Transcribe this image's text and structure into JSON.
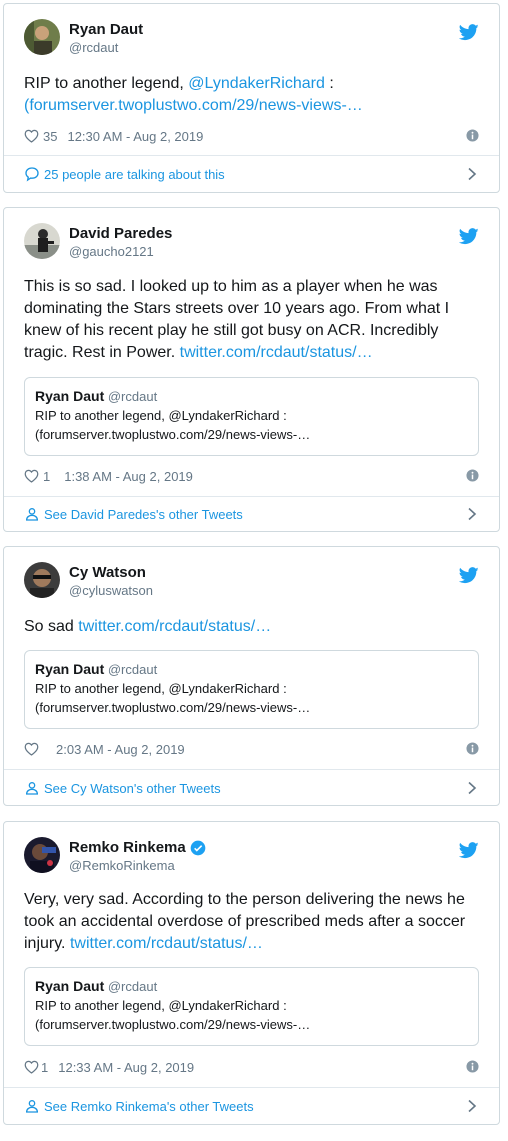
{
  "tweets": [
    {
      "name": "Ryan Daut",
      "handle": "@rcdaut",
      "text_before": "RIP to another legend, ",
      "mention": "@LyndakerRichard",
      "text_middle": " :",
      "link": "(forumserver.twoplustwo.com/29/news-views-…",
      "likes": "35",
      "time": "12:30 AM - Aug 2, 2019",
      "footer": "25 people are talking about this"
    },
    {
      "name": "David Paredes",
      "handle": "@gaucho2121",
      "text": "This is so sad. I looked up to him as a player when he was dominating the Stars streets over 10 years ago. From what I knew of his recent play he still got busy on ACR. Incredibly tragic. Rest in Power. ",
      "link": "twitter.com/rcdaut/status/…",
      "likes": "1",
      "time": "1:38 AM - Aug 2, 2019",
      "footer": "See David Paredes's other Tweets"
    },
    {
      "name": "Cy Watson",
      "handle": "@cyluswatson",
      "text": "So sad ",
      "link": "twitter.com/rcdaut/status/…",
      "likes": "",
      "time": "2:03 AM - Aug 2, 2019",
      "footer": "See Cy Watson's other Tweets"
    },
    {
      "name": "Remko Rinkema",
      "handle": "@RemkoRinkema",
      "text": "Very, very sad. According to the person delivering the news he took an accidental overdose of prescribed meds after a soccer injury. ",
      "link": "twitter.com/rcdaut/status/…",
      "likes": "1",
      "time": "12:33 AM - Aug 2, 2019",
      "footer": "See Remko Rinkema's other Tweets",
      "verified": true
    }
  ],
  "quote": {
    "name": "Ryan Daut",
    "handle": "@rcdaut",
    "line1": "RIP to another legend, @LyndakerRichard :",
    "line2": "(forumserver.twoplustwo.com/29/news-views-…"
  },
  "colors": {
    "link": "#1b95e0",
    "muted": "#657786",
    "border": "#cfd9de"
  }
}
